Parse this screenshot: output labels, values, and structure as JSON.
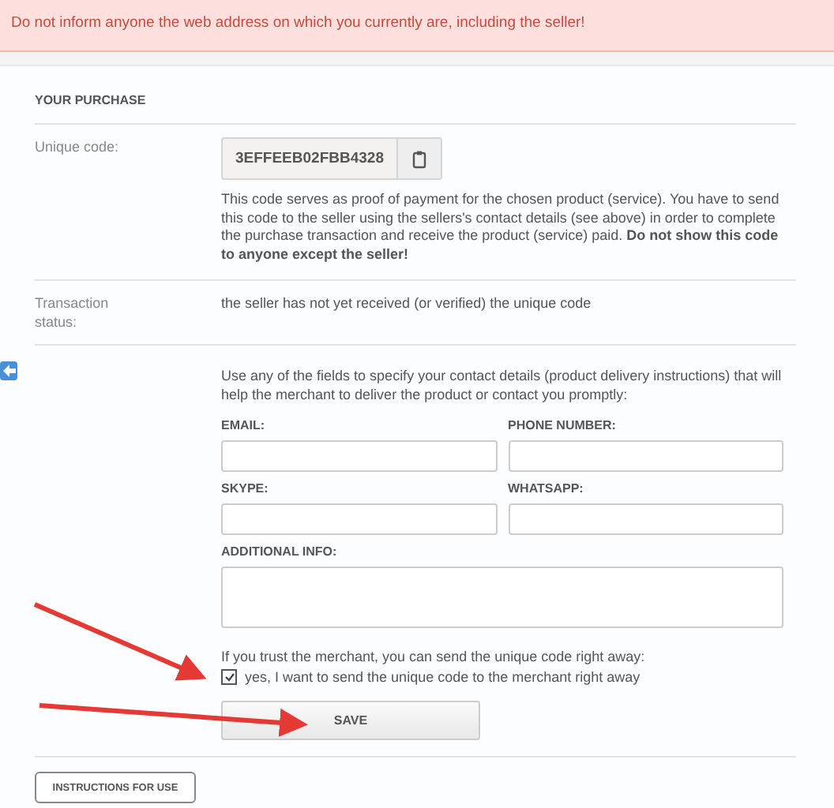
{
  "alert": "Do not inform anyone the web address on which you currently are, including the seller!",
  "section_title": "YOUR PURCHASE",
  "unique_code": {
    "label": "Unique code:",
    "value": "3EFFEEB02FBB4328",
    "description": "This code serves as proof of payment for the chosen product (service). You have to send this code to the seller using the sellers's contact details (see above) in order to complete the purchase transaction and receive the product (service) paid. **Do not show this code to anyone except the seller!**"
  },
  "transaction_status": {
    "label": "Transaction status:",
    "value": "the seller has not yet received (or verified) the unique code"
  },
  "contact_intro": "Use any of the fields to specify your contact details (product delivery instructions) that will help the merchant to deliver the product or contact you promptly:",
  "fields": [
    {
      "label": "EMAIL:"
    },
    {
      "label": "PHONE NUMBER:"
    },
    {
      "label": "SKYPE:"
    },
    {
      "label": "WHATSAPP:"
    }
  ],
  "additional_info": {
    "label": "ADDITIONAL INFO:"
  },
  "trust_note": "If you trust the merchant, you can send the unique code right away:",
  "send_now": {
    "label": "yes, I want to send the unique code to the merchant right away",
    "checked": true
  },
  "save_button": "SAVE",
  "instructions_button": "INSTRUCTIONS FOR USE"
}
